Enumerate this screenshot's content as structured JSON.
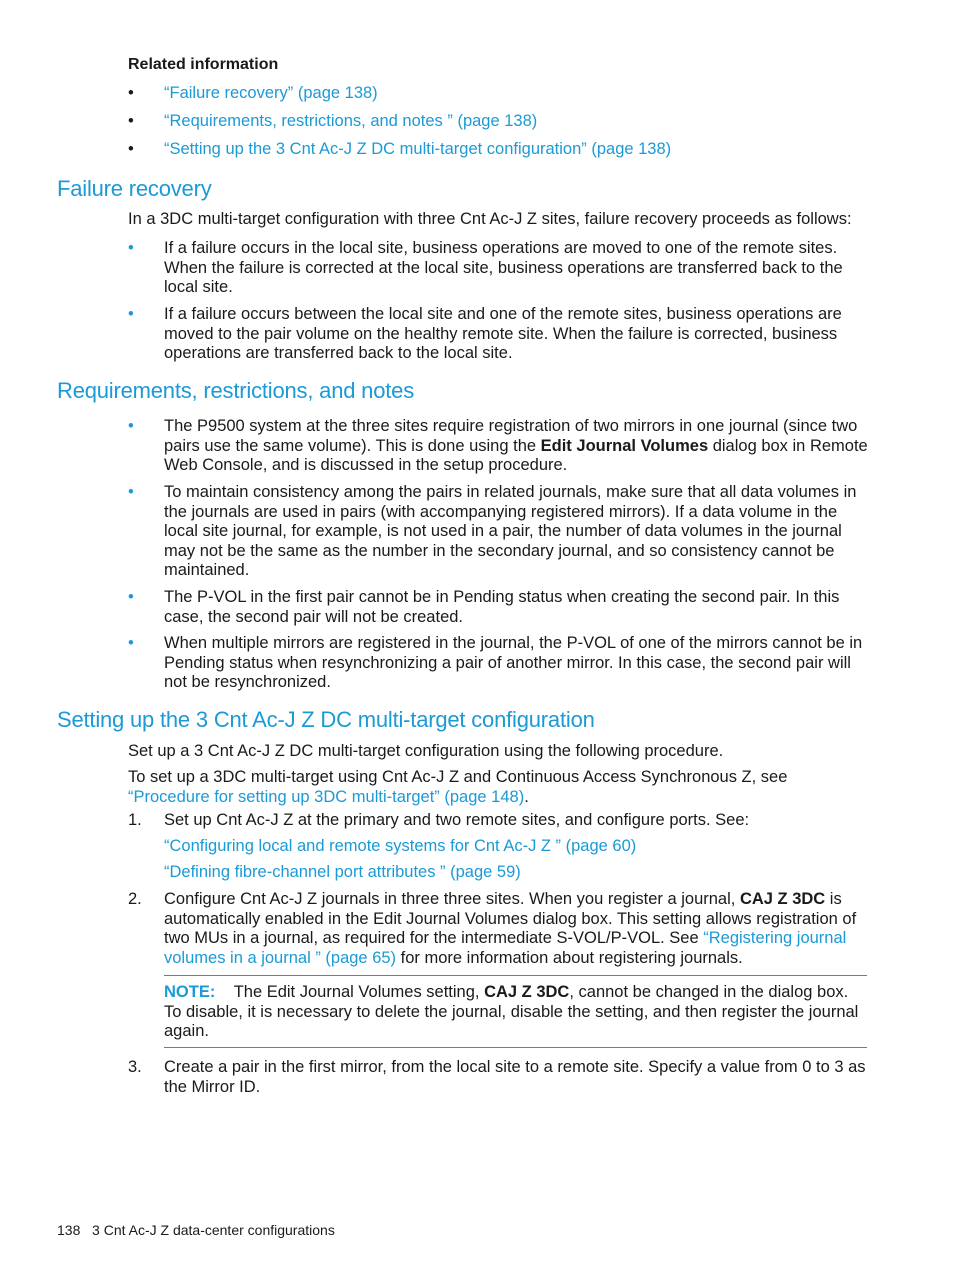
{
  "related": {
    "heading": "Related information",
    "links": [
      "“Failure recovery” (page 138)",
      "“Requirements, restrictions, and notes ” (page 138)",
      "“Setting up the 3 Cnt Ac-J Z DC multi-target configuration” (page 138)"
    ]
  },
  "failure_recovery": {
    "heading": "Failure recovery",
    "intro": "In a 3DC multi-target configuration with three Cnt Ac-J Z sites, failure recovery proceeds as follows:",
    "bullets": [
      "If a failure occurs in the local site, business operations are moved to one of the remote sites. When the failure is corrected at the local site, business operations are transferred back to the local site.",
      "If a failure occurs between the local site and one of the remote sites, business operations are moved to the pair volume on the healthy remote site. When the failure is corrected, business operations are transferred back to the local site."
    ]
  },
  "requirements": {
    "heading": "Requirements, restrictions, and notes",
    "b1_pre": "The P9500 system at the three sites require registration of two mirrors in one journal (since two pairs use the same volume). This is done using the ",
    "b1_bold": "Edit Journal Volumes",
    "b1_post": " dialog box in Remote Web Console, and is discussed in the setup procedure.",
    "b2": "To maintain consistency among the pairs in related journals, make sure that all data volumes in the journals are used in pairs (with accompanying registered mirrors). If a data volume in the local site journal, for example, is not used in a pair, the number of data volumes in the journal may not be the same as the number in the secondary journal, and so consistency cannot be maintained.",
    "b3": "The P-VOL in the first pair cannot be in Pending status when creating the second pair. In this case, the second pair will not be created.",
    "b4": "When multiple mirrors are registered in the journal, the P-VOL of one of the mirrors cannot be in Pending status when resynchronizing a pair of another mirror. In this case, the second pair will not be resynchronized."
  },
  "setup": {
    "heading": "Setting up the 3 Cnt Ac-J Z DC multi-target configuration",
    "intro": "Set up a 3 Cnt Ac-J Z DC multi-target configuration using the following procedure.",
    "para_pre": "To set up a 3DC multi-target using Cnt Ac-J Z and Continuous Access Synchronous Z, see ",
    "para_link": "“Procedure for setting up 3DC multi-target” (page 148)",
    "para_post": ".",
    "step1": {
      "num": "1.",
      "text": "Set up Cnt Ac-J Z at the primary and two remote sites, and configure ports. See:",
      "link1": "“Configuring local and remote systems for Cnt Ac-J Z ” (page 60)",
      "link2": "“Defining fibre-channel port attributes ” (page 59)"
    },
    "step2": {
      "num": "2.",
      "pre": "Configure Cnt Ac-J Z journals in three three sites. When you register a journal, ",
      "bold": "CAJ Z 3DC",
      "mid": " is automatically enabled in the Edit Journal Volumes dialog box. This setting allows registration of two MUs in a journal, as required for the intermediate S-VOL/P-VOL. See ",
      "link": "“Registering journal volumes in a journal ” (page 65)",
      "post": " for more information about registering journals."
    },
    "note": {
      "label": "NOTE:",
      "pre": "The Edit Journal Volumes setting, ",
      "bold": "CAJ Z 3DC",
      "post": ", cannot be changed in the dialog box. To disable, it is necessary to delete the journal, disable the setting, and then register the journal again."
    },
    "step3": {
      "num": "3.",
      "text": "Create a pair in the first mirror, from the local site to a remote site. Specify a value from 0 to 3 as the Mirror ID."
    }
  },
  "footer": {
    "page_number": "138",
    "chapter": "3 Cnt Ac-J Z data-center configurations"
  }
}
